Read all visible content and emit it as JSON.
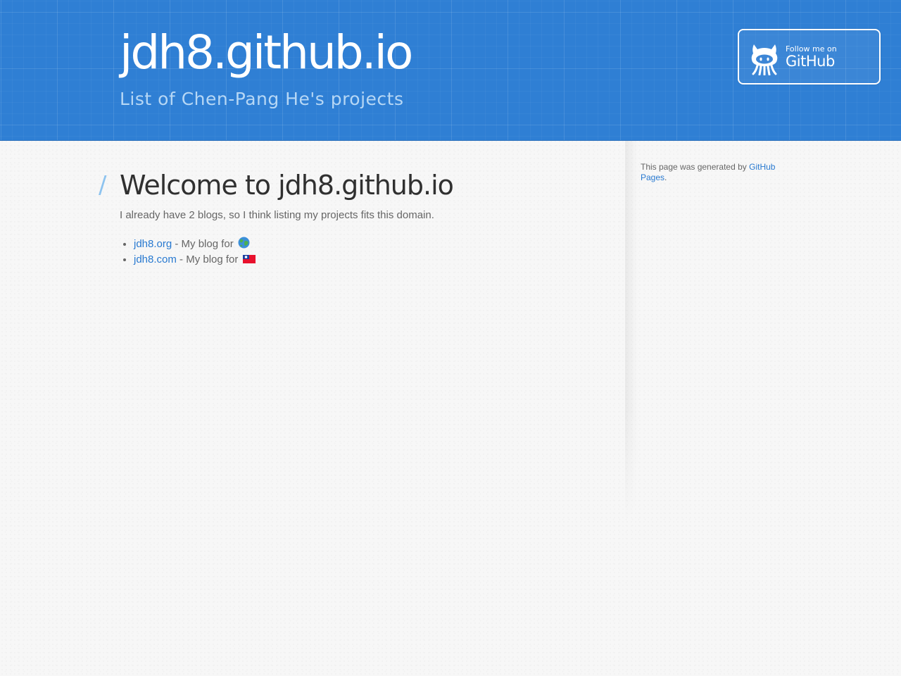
{
  "header": {
    "title": "jdh8.github.io",
    "subtitle": "List of Chen-Pang He's projects",
    "follow": {
      "small_label": "Follow me on",
      "big_label": "GitHub",
      "icon": "octocat-icon"
    }
  },
  "main": {
    "heading": "Welcome to jdh8.github.io",
    "heading_mark": "/",
    "intro": "I already have 2 blogs, so I think listing my projects fits this domain.",
    "blogs": [
      {
        "link": "jdh8.org",
        "description": " - My blog for ",
        "icon": "globe-emoji-icon"
      },
      {
        "link": "jdh8.com",
        "description": " - My blog for ",
        "icon": "taiwan-flag-icon"
      }
    ]
  },
  "sidebar": {
    "generated_prefix": "This page was generated by ",
    "generated_link": "GitHub Pages",
    "generated_suffix": "."
  },
  "colors": {
    "header_blue": "#2f7fd4",
    "link": "#2879d0",
    "heading": "#303030",
    "subtitle": "#b6d7f5"
  }
}
